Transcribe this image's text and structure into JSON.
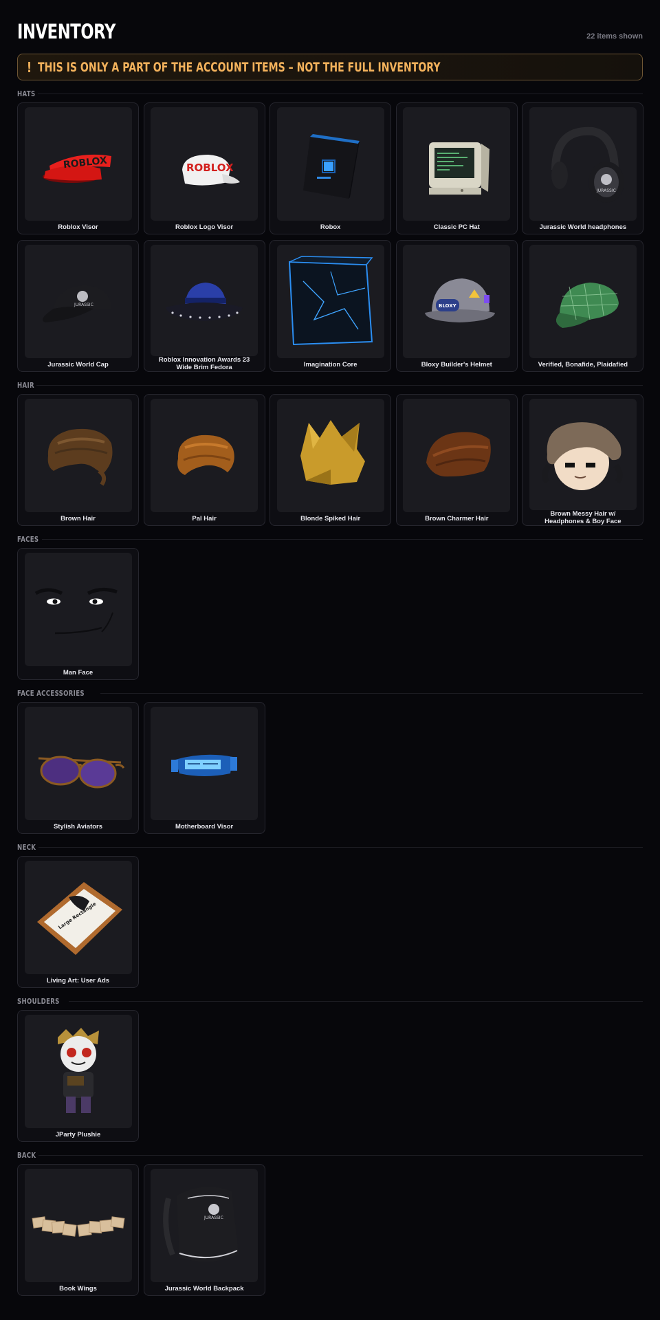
{
  "page": {
    "title": "INVENTORY",
    "item_count": "22 items shown",
    "warning_icon": "!",
    "warning_text": "THIS IS ONLY A PART OF THE ACCOUNT ITEMS – NOT THE FULL INVENTORY"
  },
  "sections": [
    {
      "label": "HATS",
      "items": [
        {
          "name": "Roblox Visor",
          "icon": "red-visor-icon"
        },
        {
          "name": "Roblox Logo Visor",
          "icon": "white-visor-icon"
        },
        {
          "name": "Robox",
          "icon": "black-box-icon"
        },
        {
          "name": "Classic PC Hat",
          "icon": "computer-monitor-icon"
        },
        {
          "name": "Jurassic World headphones",
          "icon": "headphones-icon"
        },
        {
          "name": "Jurassic World Cap",
          "icon": "black-cap-icon"
        },
        {
          "name": "Roblox Innovation Awards 23 Wide Brim Fedora",
          "icon": "blue-fedora-icon"
        },
        {
          "name": "Imagination Core",
          "icon": "glowing-cube-icon"
        },
        {
          "name": "Bloxy Builder's Helmet",
          "icon": "hard-hat-icon"
        },
        {
          "name": "Verified, Bonafide, Plaidafied",
          "icon": "plaid-cap-icon"
        }
      ]
    },
    {
      "label": "HAIR",
      "items": [
        {
          "name": "Brown Hair",
          "icon": "brown-hair-icon"
        },
        {
          "name": "Pal Hair",
          "icon": "orange-hair-icon"
        },
        {
          "name": "Blonde Spiked Hair",
          "icon": "blonde-spiked-hair-icon"
        },
        {
          "name": "Brown Charmer Hair",
          "icon": "charmer-hair-icon"
        },
        {
          "name": "Brown Messy Hair w/ Headphones & Boy Face",
          "icon": "messy-hair-face-icon"
        }
      ]
    },
    {
      "label": "FACES",
      "items": [
        {
          "name": "Man Face",
          "icon": "man-face-icon"
        }
      ]
    },
    {
      "label": "FACE ACCESSORIES",
      "items": [
        {
          "name": "Stylish Aviators",
          "icon": "aviator-glasses-icon"
        },
        {
          "name": "Motherboard Visor",
          "icon": "motherboard-visor-icon"
        }
      ]
    },
    {
      "label": "NECK",
      "items": [
        {
          "name": "Living Art: User Ads",
          "icon": "framed-art-icon"
        }
      ]
    },
    {
      "label": "SHOULDERS",
      "items": [
        {
          "name": "JParty Plushie",
          "icon": "plushie-figure-icon"
        }
      ]
    },
    {
      "label": "BACK",
      "items": [
        {
          "name": "Book Wings",
          "icon": "book-wings-icon"
        },
        {
          "name": "Jurassic World Backpack",
          "icon": "backpack-icon"
        }
      ]
    }
  ]
}
